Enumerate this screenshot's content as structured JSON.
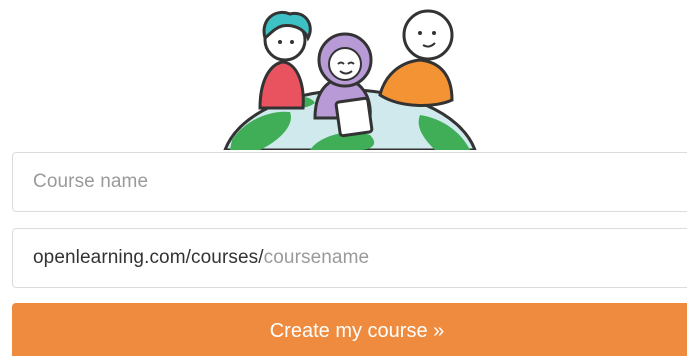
{
  "illustration": {
    "icon": "people-around-globe-illustration"
  },
  "form": {
    "course_name_placeholder": "Course name",
    "url_prefix": "openlearning.com/courses/",
    "url_placeholder_suffix": "coursename",
    "submit_label": "Create my course »"
  },
  "colors": {
    "button_bg": "#ef8b3f",
    "button_text": "#ffffff",
    "placeholder": "#9a9a9a",
    "text": "#333333",
    "field_border": "#dcdcdc"
  }
}
